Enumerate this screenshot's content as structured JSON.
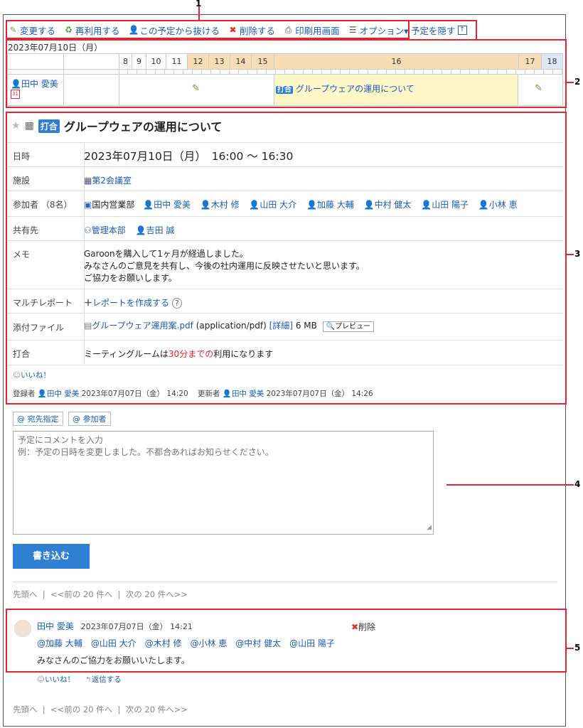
{
  "toolbar": {
    "change": "変更する",
    "reuse": "再利用する",
    "leave": "この予定から抜ける",
    "delete": "削除する",
    "print": "印刷用画面",
    "options": "オプション▾",
    "hide": "予定を隠す"
  },
  "timeline": {
    "date": "2023年07月10日（月）",
    "hours": [
      "8",
      "9",
      "10",
      "11",
      "12",
      "13",
      "14",
      "15",
      "16",
      "17",
      "18"
    ],
    "user": "田中 愛美",
    "event_badge": "打合",
    "event_title": "グループウェアの運用について"
  },
  "detail": {
    "badge": "打合",
    "title": "グループウェアの運用について",
    "rows": {
      "datetime_label": "日時",
      "datetime_value": "2023年07月10日（月）　16:00 〜 16:30",
      "facility_label": "施設",
      "facility_value": "第2会議室",
      "participants_label": "参加者 （8名）",
      "participants": [
        "国内営業部",
        "田中 愛美",
        "木村 修",
        "山田 大介",
        "加藤 大輔",
        "中村 健太",
        "山田 陽子",
        "小林 恵"
      ],
      "share_label": "共有先",
      "share": [
        "管理本部",
        "吉田 誠"
      ],
      "memo_label": "メモ",
      "memo1": "Garoonを購入して1ヶ月が経過しました。",
      "memo2": "みなさんのご意見を共有し、今後の社内運用に反映させたいと思います。",
      "memo3": "ご協力をお願いします。",
      "multi_label": "マルチレポート",
      "multi_value": "レポートを作成する",
      "attach_label": "添付ファイル",
      "attach_name": "グループウェア運用案.pdf",
      "attach_type": "(application/pdf)",
      "attach_detail": "[詳細]",
      "attach_size": "6 MB",
      "preview": "プレビュー",
      "meeting_label": "打合",
      "meeting_pre": "ミーティングルームは",
      "meeting_red": "30分までの",
      "meeting_post": "利用になります"
    },
    "like": "いいね！",
    "meta_registered": "登録者",
    "meta_reg_user": "田中 愛美",
    "meta_reg_date": "2023年07月07日（金） 14:20",
    "meta_updated": "更新者",
    "meta_upd_user": "田中 愛美",
    "meta_upd_date": "2023年07月07日（金） 14:26"
  },
  "comment_form": {
    "mention_to": "@ 宛先指定",
    "mention_participants": "@ 参加者",
    "placeholder1": "予定にコメントを入力",
    "placeholder2": "例：予定の日時を変更しました。不都合あればお知らせください。",
    "submit": "書き込む"
  },
  "pager": {
    "first": "先頭へ",
    "prev": "<<前の 20 件へ",
    "next": "次の 20 件へ>>"
  },
  "comment": {
    "author": "田中 愛美",
    "date": "2023年07月07日（金） 14:21",
    "delete": "削除",
    "mentions": "@加藤 大輔　@山田 大介　@木村 修　@小林 恵　@中村 健太　@山田 陽子",
    "body": "みなさんのご協力をお願いいたします。",
    "like": "いいね！",
    "reply": "返信する"
  },
  "callouts": [
    "1",
    "2",
    "3",
    "4",
    "5"
  ]
}
